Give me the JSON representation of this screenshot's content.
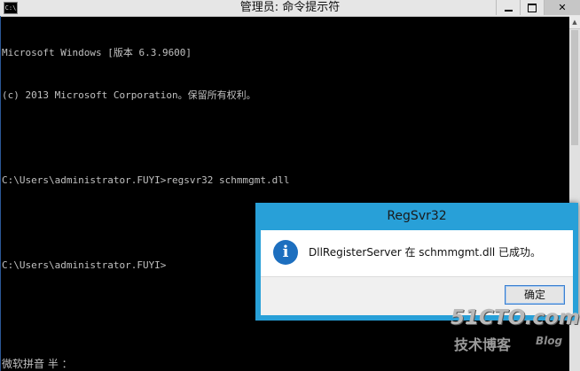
{
  "window": {
    "title": "管理员: 命令提示符",
    "icon_label": "C:\\",
    "icon": "console-app-icon",
    "controls": {
      "minimize_icon": "minimize-icon",
      "maximize_icon": "maximize-icon",
      "close_icon": "close-icon",
      "close_glyph": "✕"
    }
  },
  "console": {
    "lines": [
      "Microsoft Windows [版本 6.3.9600]",
      "(c) 2013 Microsoft Corporation。保留所有权利。",
      "",
      "C:\\Users\\administrator.FUYI>regsvr32 schmmgmt.dll",
      "",
      "C:\\Users\\administrator.FUYI>"
    ],
    "ime_status": "微软拼音 半 ："
  },
  "dialog": {
    "title": "RegSvr32",
    "icon": "info-icon",
    "icon_glyph": "i",
    "message": "DllRegisterServer 在 schmmgmt.dll 已成功。",
    "ok_label": "确定"
  },
  "watermark": {
    "main": "51CTO.com",
    "sub": "技术博客",
    "blog": "Blog"
  },
  "colors": {
    "console_bg": "#000000",
    "console_text": "#c0c0c0",
    "dialog_accent": "#28a0d8",
    "info_icon": "#1d6fbf"
  }
}
